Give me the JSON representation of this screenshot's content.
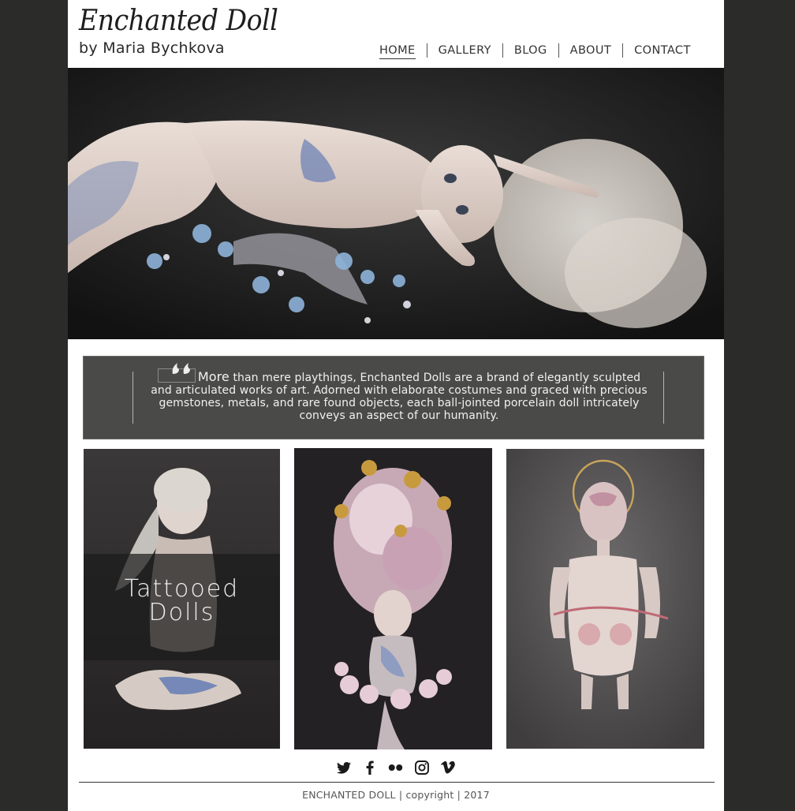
{
  "brand": {
    "title": "Enchanted Doll",
    "subtitle": "by Maria Bychkova"
  },
  "nav": {
    "items": [
      {
        "label": "HOME",
        "active": true
      },
      {
        "label": "GALLERY",
        "active": false
      },
      {
        "label": "BLOG",
        "active": false
      },
      {
        "label": "ABOUT",
        "active": false
      },
      {
        "label": "CONTACT",
        "active": false
      }
    ]
  },
  "quote": {
    "lead": "More",
    "text": " than mere playthings, Enchanted Dolls are a brand of elegantly sculpted and articulated works of art. Adorned with elaborate costumes and graced with precious gemstones, metals, and rare found objects, each ball-jointed porcelain doll intricately conveys an aspect of our humanity."
  },
  "gallery": {
    "cards": [
      {
        "overlay_line1": "Tattooed",
        "overlay_line2": "Dolls"
      },
      {},
      {}
    ]
  },
  "social": {
    "icons": [
      "twitter-icon",
      "facebook-icon",
      "flickr-icon",
      "instagram-icon",
      "vimeo-icon"
    ]
  },
  "footer": {
    "copyright": "ENCHANTED DOLL | copyright | 2017"
  },
  "colors": {
    "page_background": "#2b2b2a",
    "quote_background": "#4a4a49",
    "content_background": "#ffffff"
  }
}
